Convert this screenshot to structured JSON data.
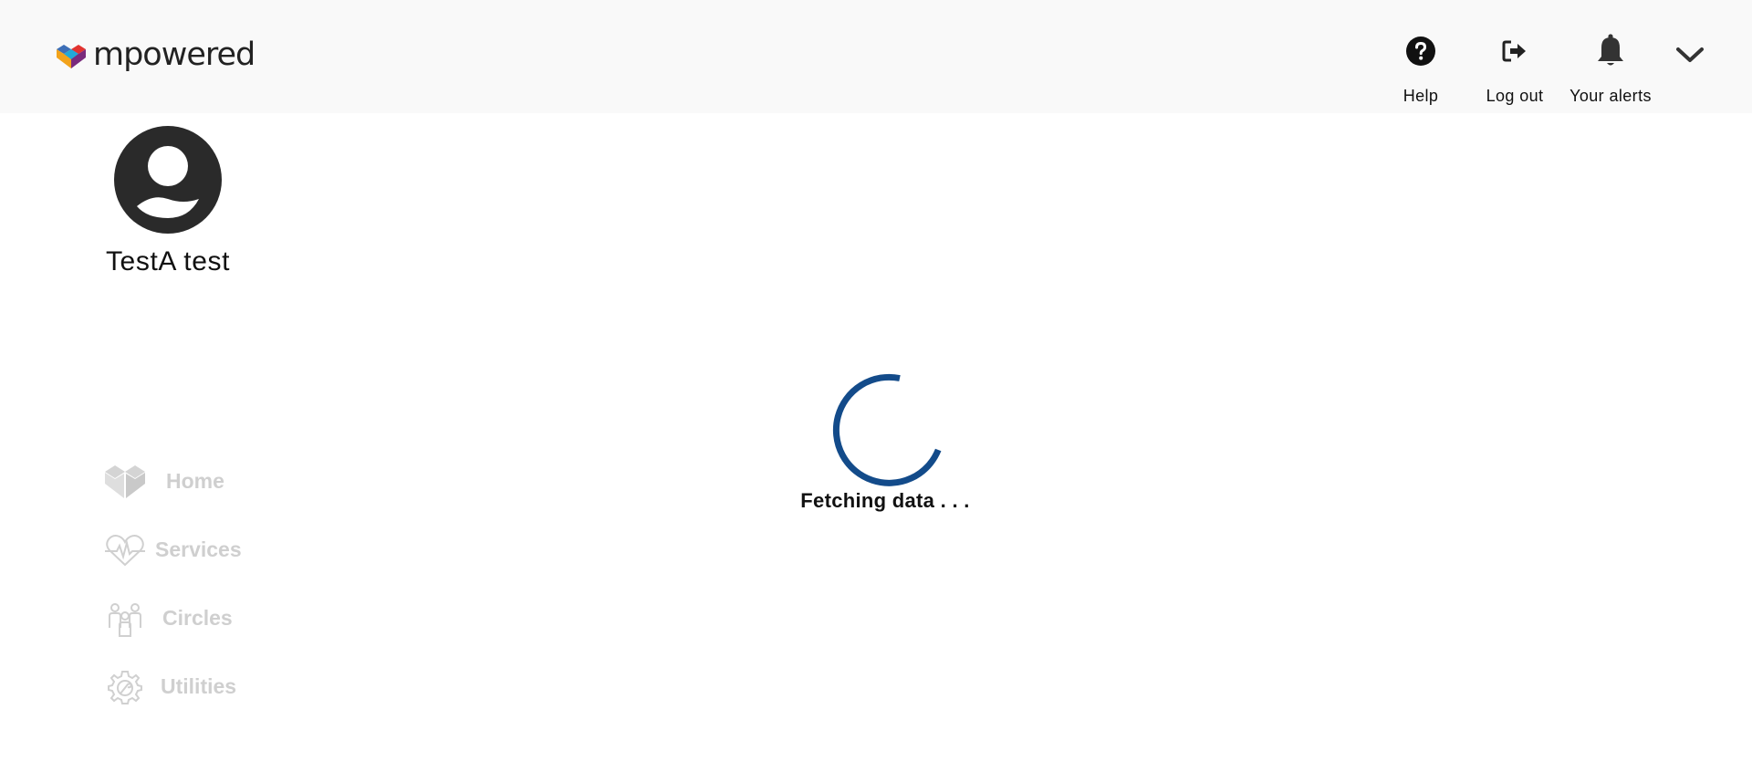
{
  "header": {
    "logo_text": "mpowered",
    "help_label": "Help",
    "logout_label": "Log out",
    "alerts_label": "Your alerts"
  },
  "profile": {
    "name": "TestA test"
  },
  "nav": {
    "items": [
      {
        "label": "Home",
        "icon": "heart-logo-icon"
      },
      {
        "label": "Services",
        "icon": "heart-pulse-icon"
      },
      {
        "label": "Circles",
        "icon": "people-group-icon"
      },
      {
        "label": "Utilities",
        "icon": "gear-wrench-icon"
      }
    ]
  },
  "loader": {
    "text": "Fetching data . . ."
  },
  "colors": {
    "spinner": "#134b8a",
    "nav_disabled": "#cfcfcf",
    "header_bg": "#f9f9f9"
  }
}
